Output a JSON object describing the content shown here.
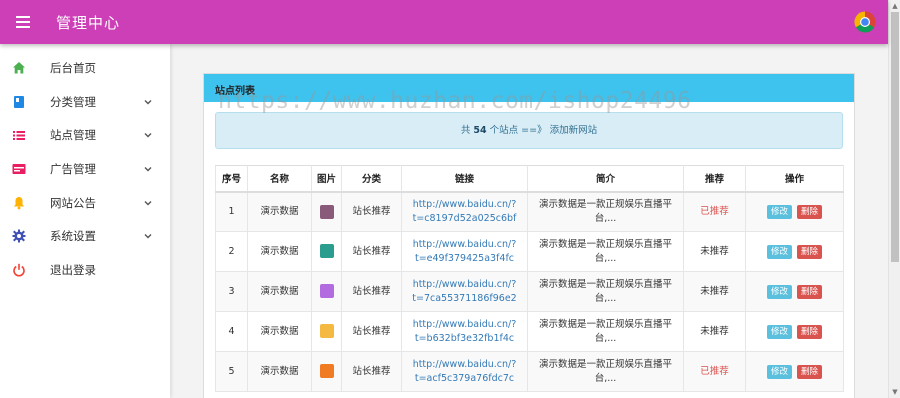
{
  "header": {
    "title": "管理中心"
  },
  "sidebar": {
    "items": [
      {
        "label": "后台首页",
        "icon": "home-icon",
        "color": "#4caf50",
        "chevron": false
      },
      {
        "label": "分类管理",
        "icon": "book-icon",
        "color": "#1e88e5",
        "chevron": true
      },
      {
        "label": "站点管理",
        "icon": "list-icon",
        "color": "#e91e63",
        "chevron": true
      },
      {
        "label": "广告管理",
        "icon": "ad-window-icon",
        "color": "#e91e63",
        "chevron": true
      },
      {
        "label": "网站公告",
        "icon": "bell-icon",
        "color": "#ffb300",
        "chevron": true
      },
      {
        "label": "系统设置",
        "icon": "gear-icon",
        "color": "#3f51b5",
        "chevron": true
      },
      {
        "label": "退出登录",
        "icon": "power-icon",
        "color": "#f44336",
        "chevron": false
      }
    ]
  },
  "panel": {
    "title": "站点列表",
    "info_prefix": "共",
    "info_count": "54",
    "info_suffix": "个站点 ==》",
    "add_link": "添加新网站"
  },
  "watermark": "https://www.huzhan.com/ishop24496",
  "table": {
    "headers": [
      "序号",
      "名称",
      "图片",
      "分类",
      "链接",
      "简介",
      "推荐",
      "操作"
    ],
    "rows": [
      {
        "id": "1",
        "name": "演示数据",
        "thumb_color": "#8a5a7a",
        "category": "站长推荐",
        "link1": "http://www.baidu.cn/?",
        "link2": "t=c8197d52a025c6bf",
        "desc1": "演示数据是一款正规娱乐直播平",
        "desc2": "台,...",
        "rec": "已推荐",
        "rec_color": "#d9534f",
        "edit": "修改",
        "del": "删除"
      },
      {
        "id": "2",
        "name": "演示数据",
        "thumb_color": "#2a9d8f",
        "category": "站长推荐",
        "link1": "http://www.baidu.cn/?",
        "link2": "t=e49f379425a3f4fc",
        "desc1": "演示数据是一款正规娱乐直播平",
        "desc2": "台,...",
        "rec": "未推荐",
        "rec_color": "#333333",
        "edit": "修改",
        "del": "删除"
      },
      {
        "id": "3",
        "name": "演示数据",
        "thumb_color": "#b36be0",
        "category": "站长推荐",
        "link1": "http://www.baidu.cn/?",
        "link2": "t=7ca55371186f96e2",
        "desc1": "演示数据是一款正规娱乐直播平",
        "desc2": "台,...",
        "rec": "未推荐",
        "rec_color": "#333333",
        "edit": "修改",
        "del": "删除"
      },
      {
        "id": "4",
        "name": "演示数据",
        "thumb_color": "#f5b942",
        "category": "站长推荐",
        "link1": "http://www.baidu.cn/?",
        "link2": "t=b632bf3e32fb1f4c",
        "desc1": "演示数据是一款正规娱乐直播平",
        "desc2": "台,...",
        "rec": "未推荐",
        "rec_color": "#333333",
        "edit": "修改",
        "del": "删除"
      },
      {
        "id": "5",
        "name": "演示数据",
        "thumb_color": "#f07b22",
        "category": "站长推荐",
        "link1": "http://www.baidu.cn/?",
        "link2": "t=acf5c379a76fdc7c",
        "desc1": "演示数据是一款正规娱乐直播平",
        "desc2": "台,...",
        "rec": "已推荐",
        "rec_color": "#d9534f",
        "edit": "修改",
        "del": "删除"
      }
    ]
  }
}
